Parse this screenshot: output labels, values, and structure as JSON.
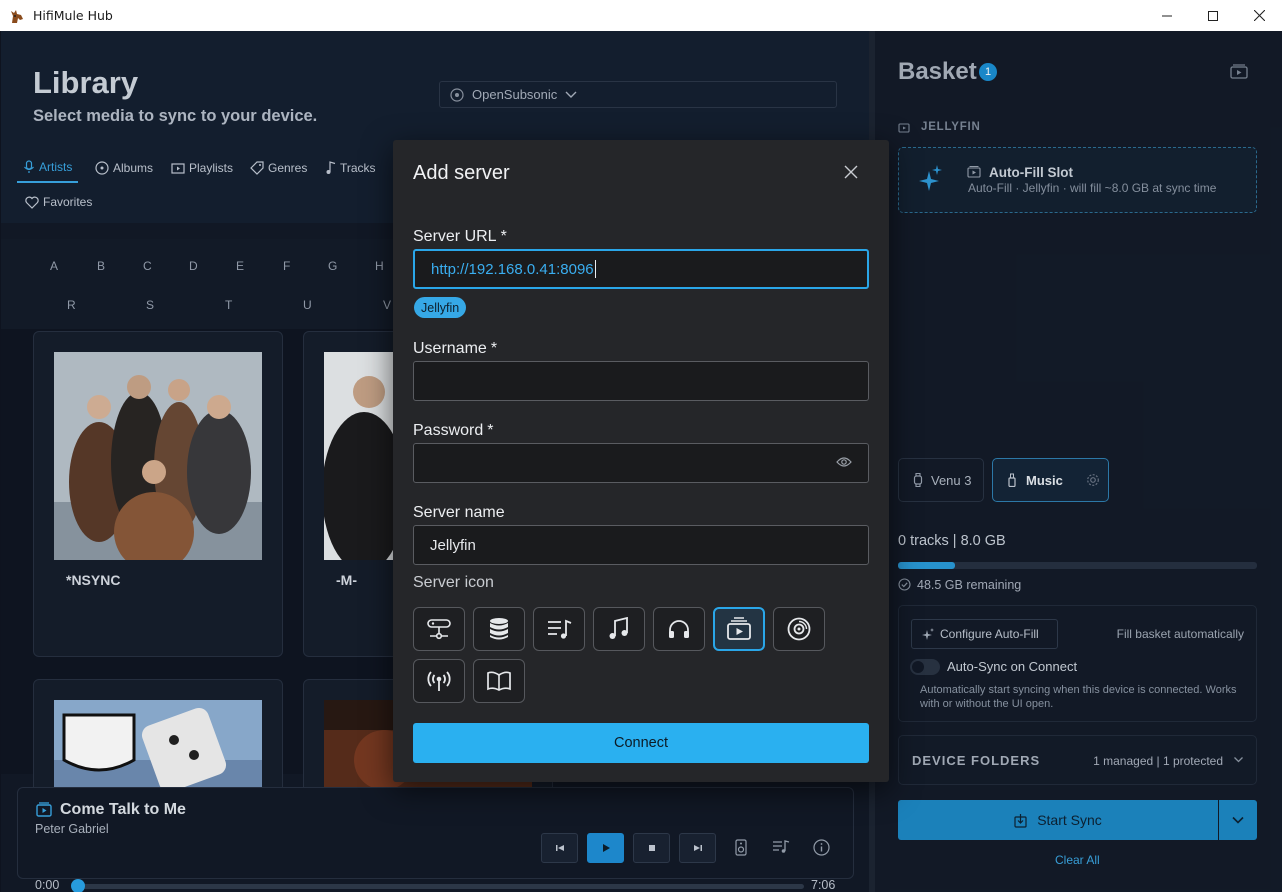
{
  "window": {
    "title": "HifiMule Hub"
  },
  "library": {
    "title": "Library",
    "subtitle": "Select media to sync to your device.",
    "source": "OpenSubsonic",
    "tabs": [
      {
        "label": "Artists",
        "icon": "microphone-icon",
        "active": true
      },
      {
        "label": "Albums",
        "icon": "album-icon"
      },
      {
        "label": "Playlists",
        "icon": "playlist-icon"
      },
      {
        "label": "Genres",
        "icon": "tag-icon"
      },
      {
        "label": "Tracks",
        "icon": "music-note-icon"
      },
      {
        "label": "Favorites",
        "icon": "heart-icon"
      }
    ],
    "alphabet_row1": [
      "A",
      "B",
      "C",
      "D",
      "E",
      "F",
      "G",
      "H"
    ],
    "alphabet_row2": [
      "R",
      "S",
      "T",
      "U",
      "V"
    ],
    "artists": [
      {
        "name": "*NSYNC"
      },
      {
        "name": "-M-"
      },
      {
        "name": ""
      },
      {
        "name": ""
      }
    ]
  },
  "player": {
    "title": "Come Talk to Me",
    "artist": "Peter Gabriel",
    "elapsed": "0:00",
    "duration": "7:06",
    "progress": 0.0
  },
  "basket": {
    "title": "Basket",
    "count": "1",
    "server_label": "JELLYFIN",
    "autofill_title": "Auto-Fill Slot",
    "autofill_sub": "Auto-Fill · Jellyfin · will fill ~8.0 GB at sync time",
    "devices": [
      {
        "label": "Venu 3",
        "icon": "watch-icon"
      },
      {
        "label": "Music",
        "icon": "usb-drive-icon",
        "selected": true
      }
    ],
    "tracks_info": "0 tracks | 8.0 GB",
    "capacity_used": 0.16,
    "remaining": "48.5 GB remaining",
    "configure_autofill": "Configure Auto-Fill",
    "fill_auto": "Fill basket automatically",
    "autosync_label": "Auto-Sync on Connect",
    "autosync_on": false,
    "autosync_desc": "Automatically start syncing when this device is connected. Works with or without the UI open.",
    "device_folders": "DEVICE FOLDERS",
    "device_folders_info": "1 managed | 1 protected",
    "start_sync": "Start Sync",
    "clear_all": "Clear All"
  },
  "modal": {
    "title": "Add server",
    "url_label": "Server URL",
    "url_value": "http://192.168.0.41:8096",
    "detected": "Jellyfin",
    "username_label": "Username",
    "username_value": "",
    "password_label": "Password",
    "password_value": "",
    "name_label": "Server name",
    "name_value": "Jellyfin",
    "icon_label": "Server icon",
    "required_mark": "*",
    "icons": [
      "server-network-icon",
      "database-icon",
      "playlist-music-icon",
      "music-note-icon",
      "headphones-icon",
      "media-library-icon",
      "disc-icon",
      "broadcast-icon",
      "book-icon"
    ],
    "selected_icon": "media-library-icon",
    "connect": "Connect"
  },
  "colors": {
    "accent": "#2ab0f0",
    "modal_bg": "#252629",
    "app_bg": "#121a28"
  }
}
